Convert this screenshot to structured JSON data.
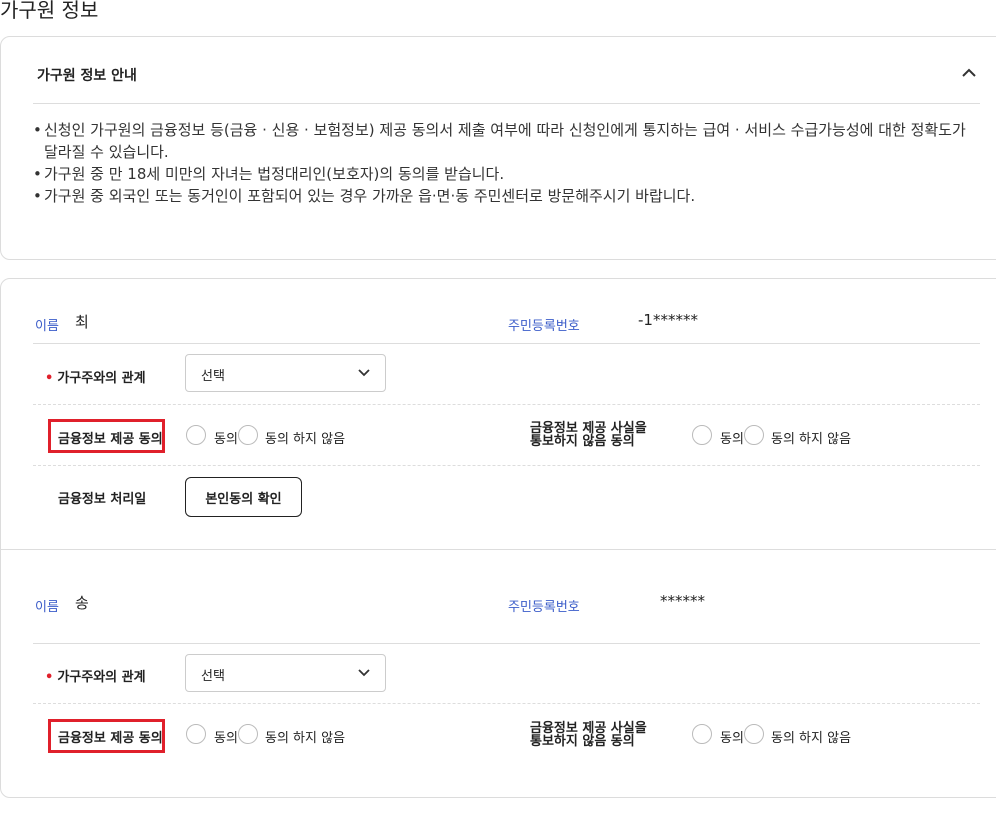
{
  "page": {
    "title": "가구원 정보"
  },
  "guide": {
    "title": "가구원 정보 안내",
    "bullets": [
      "신청인 가구원의 금융정보 등(금융 · 신용 · 보험정보) 제공 동의서 제출 여부에 따라 신청인에게 통지하는 급여 · 서비스 수급가능성에 대한 정확도가 달라질 수 있습니다.",
      "가구원 중 만 18세 미만의 자녀는 법정대리인(보호자)의 동의를 받습니다.",
      "가구원 중 외국인 또는 동거인이 포함되어 있는 경우 가까운 읍·면·동 주민센터로 방문해주시기 바랍니다."
    ]
  },
  "members": [
    {
      "name_label": "이름",
      "name_value": "최",
      "rrn_label": "주민등록번호",
      "rrn_value": "-1******",
      "relation_label": "가구주와의 관계",
      "relation_value": "선택",
      "consent_label": "금융정보 제공 동의",
      "consent_yes": "동의",
      "consent_no": "동의 하지 않음",
      "notice_label_line1": "금융정보 제공 사실을",
      "notice_label_line2": "통보하지 않음 동의",
      "notice_yes": "동의",
      "notice_no": "동의 하지 않음",
      "process_label": "금융정보 처리일",
      "process_button": "본인동의 확인"
    },
    {
      "name_label": "이름",
      "name_value": "송",
      "rrn_label": "주민등록번호",
      "rrn_value": "******",
      "relation_label": "가구주와의 관계",
      "relation_value": "선택",
      "consent_label": "금융정보 제공 동의",
      "consent_yes": "동의",
      "consent_no": "동의 하지 않음",
      "notice_label_line1": "금융정보 제공 사실을",
      "notice_label_line2": "통보하지 않음 동의",
      "notice_yes": "동의",
      "notice_no": "동의 하지 않음"
    }
  ],
  "colors": {
    "label_blue": "#3b5cc9",
    "required_red": "#e0202b",
    "highlight_red": "#e0202b"
  },
  "icons": {
    "collapse": "chevron-up-icon",
    "select": "chevron-down-icon"
  }
}
